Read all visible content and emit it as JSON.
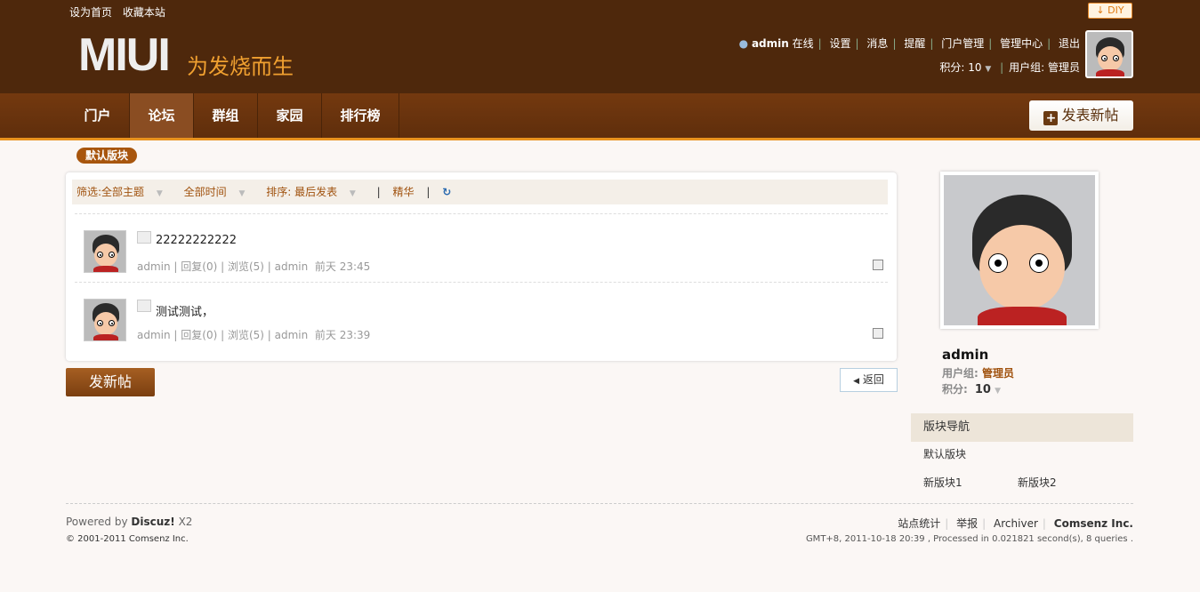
{
  "top": {
    "set_home": "设为首页",
    "bookmark": "收藏本站",
    "diy": "DIY"
  },
  "logo": {
    "text": "MIUI",
    "slogan": "为发烧而生"
  },
  "user": {
    "name": "admin",
    "status": "在线",
    "links": [
      "设置",
      "消息",
      "提醒",
      "门户管理",
      "管理中心",
      "退出"
    ],
    "score_label": "积分: 10",
    "group_label": "用户组: 管理员"
  },
  "nav": {
    "items": [
      "门户",
      "论坛",
      "群组",
      "家园",
      "排行榜"
    ],
    "post_button": "发表新帖"
  },
  "breadcrumb": "默认版块",
  "filter": {
    "type": "筛选:全部主题",
    "time": "全部时间",
    "sort": "排序: 最后发表",
    "digest": "精华"
  },
  "threads": [
    {
      "title": "22222222222",
      "author": "admin",
      "replies": "回复(0)",
      "views": "浏览(5)",
      "last": "admin",
      "time": "前天 23:45"
    },
    {
      "title": "测试测试，",
      "author": "admin",
      "replies": "回复(0)",
      "views": "浏览(5)",
      "last": "admin",
      "time": "前天 23:39"
    }
  ],
  "buttons": {
    "new_thread": "发新帖",
    "back": "返回"
  },
  "profile": {
    "name": "admin",
    "group_label": "用户组:",
    "group": "管理员",
    "score_label": "积分:",
    "score": "10"
  },
  "forum_nav": {
    "title": "版块导航",
    "items": [
      "默认版块",
      "新版块1",
      "新版块2"
    ]
  },
  "footer": {
    "powered": "Powered by",
    "brand": "Discuz!",
    "version": "X2",
    "copyright": "© 2001-2011 Comsenz Inc.",
    "links": [
      "站点统计",
      "举报",
      "Archiver",
      "Comsenz Inc."
    ],
    "stats": "GMT+8, 2011-10-18 20:39 , Processed in 0.021821 second(s), 8 queries ."
  }
}
